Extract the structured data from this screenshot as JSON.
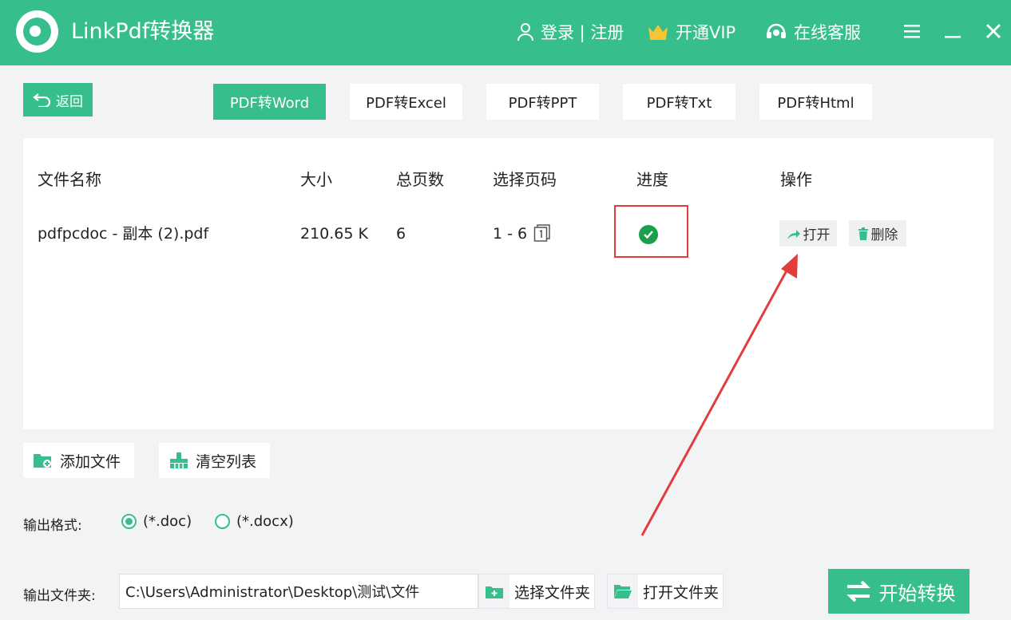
{
  "app": {
    "title": "LinkPdf转换器"
  },
  "header": {
    "login": "登录 | 注册",
    "vip": "开通VIP",
    "service": "在线客服"
  },
  "nav": {
    "back": "返回"
  },
  "tabs": [
    {
      "label": "PDF转Word",
      "active": true
    },
    {
      "label": "PDF转Excel"
    },
    {
      "label": "PDF转PPT"
    },
    {
      "label": "PDF转Txt"
    },
    {
      "label": "PDF转Html"
    }
  ],
  "table": {
    "headers": [
      "文件名称",
      "大小",
      "总页数",
      "选择页码",
      "进度",
      "操作"
    ],
    "rows": [
      {
        "name": "pdfpcdoc - 副本 (2).pdf",
        "size": "210.65 K",
        "pages": "6",
        "range": "1 - 6",
        "progress": "complete",
        "open": "打开",
        "delete": "删除"
      }
    ]
  },
  "actions": {
    "add_file": "添加文件",
    "clear_list": "清空列表"
  },
  "output": {
    "format_label": "输出格式:",
    "formats": [
      "(*.doc)",
      "(*.docx)"
    ],
    "selected_format": "(*.doc)",
    "folder_label": "输出文件夹:",
    "folder_path": "C:\\Users\\Administrator\\Desktop\\测试\\文件",
    "select_folder": "选择文件夹",
    "open_folder": "打开文件夹",
    "start": "开始转换"
  },
  "colors": {
    "accent": "#36bf8d",
    "success": "#1aa04a",
    "annotation": "#e23c3c"
  }
}
